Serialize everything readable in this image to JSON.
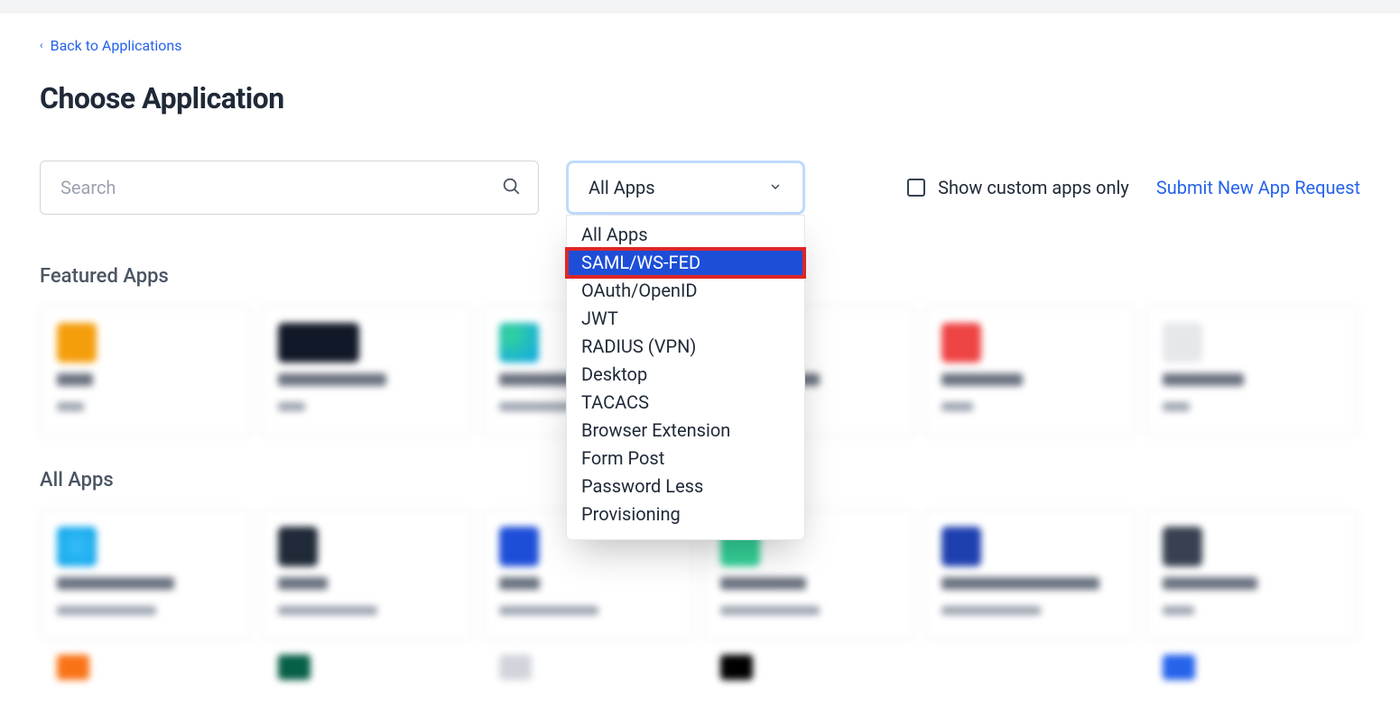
{
  "nav": {
    "back_label": "Back to Applications"
  },
  "page": {
    "title": "Choose Application"
  },
  "search": {
    "placeholder": "Search",
    "value": ""
  },
  "filter": {
    "selected": "All Apps",
    "options": [
      "All Apps",
      "SAML/WS-FED",
      "OAuth/OpenID",
      "JWT",
      "RADIUS (VPN)",
      "Desktop",
      "TACACS",
      "Browser Extension",
      "Form Post",
      "Password Less",
      "Provisioning"
    ],
    "highlighted_index": 1
  },
  "toggles": {
    "custom_only_label": "Show custom apps only",
    "custom_only_checked": false
  },
  "links": {
    "submit_request": "Submit New App Request"
  },
  "sections": {
    "featured": "Featured Apps",
    "all": "All Apps"
  }
}
